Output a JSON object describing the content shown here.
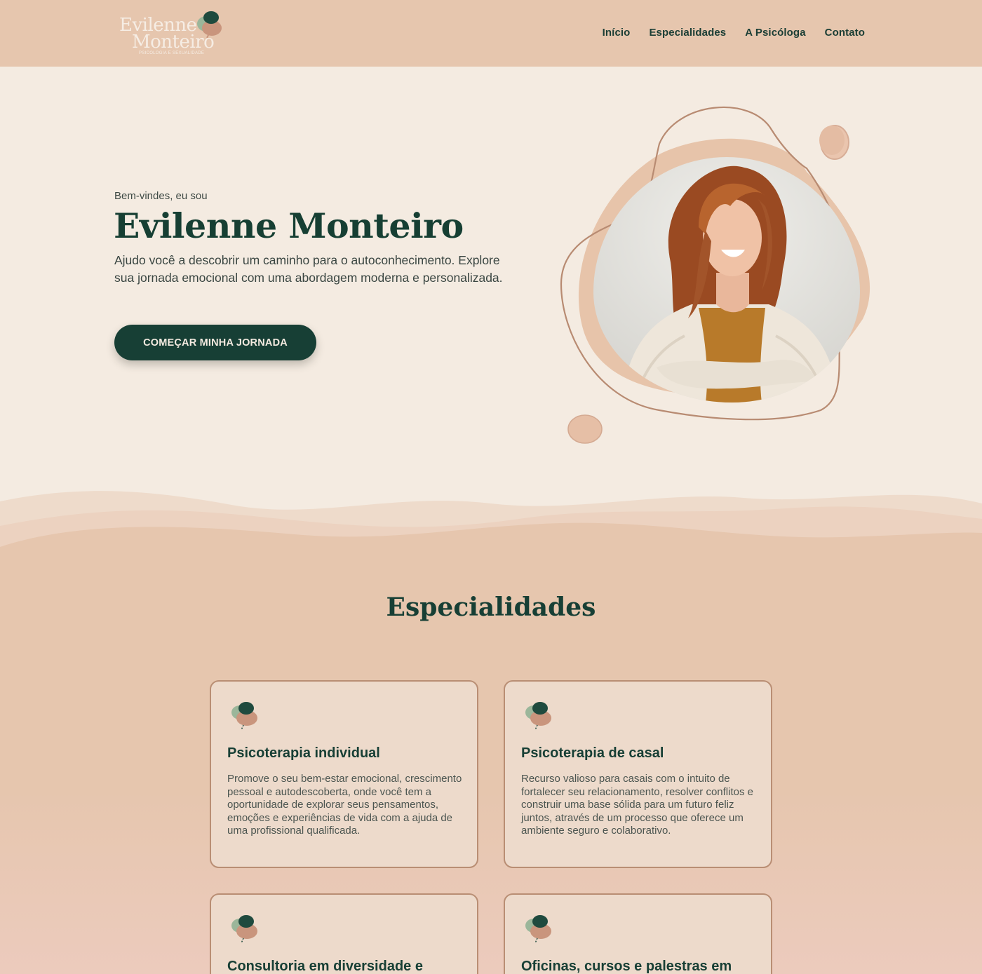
{
  "header": {
    "logo": {
      "line1": "Evilenne",
      "line2": "Monteiro",
      "tagline": "PSICOLOGIA E SEXUALIDADE"
    },
    "nav": [
      {
        "label": "Início"
      },
      {
        "label": "Especialidades"
      },
      {
        "label": "A Psicóloga"
      },
      {
        "label": "Contato"
      }
    ]
  },
  "hero": {
    "greeting": "Bem-vindes, eu sou",
    "title": "Evilenne Monteiro",
    "text": "Ajudo você a descobrir um caminho para o autoconhecimento. Explore sua jornada emocional com uma abordagem moderna e personalizada.",
    "cta_label": "COMEÇAR MINHA JORNADA",
    "portrait_icon": "person-portrait"
  },
  "specialties": {
    "title": "Especialidades",
    "cards": [
      {
        "title": "Psicoterapia individual",
        "text": "Promove o seu bem-estar emocional, crescimento pessoal e autodescoberta, onde você tem a oportunidade de explorar seus pensamentos, emoções e experiências de vida com a ajuda de uma profissional qualificada.",
        "icon": "brain-leaf-icon"
      },
      {
        "title": "Psicoterapia de casal",
        "text": "Recurso valioso para casais com o intuito de fortalecer seu relacionamento, resolver conflitos e construir uma base sólida para um futuro feliz juntos, através de um processo que oferece um ambiente seguro e colaborativo.",
        "icon": "brain-leaf-icon"
      },
      {
        "title": "Consultoria em diversidade e",
        "text": "",
        "icon": "brain-leaf-icon"
      },
      {
        "title": "Oficinas, cursos e palestras em",
        "text": "",
        "icon": "brain-leaf-icon"
      }
    ]
  },
  "colors": {
    "header_bg": "#e6c6ae",
    "page_bg": "#f4ebe1",
    "primary": "#173f35",
    "card_bg": "#eddacb",
    "card_border": "#b98e74",
    "accent_blob": "#e6c0a6"
  }
}
